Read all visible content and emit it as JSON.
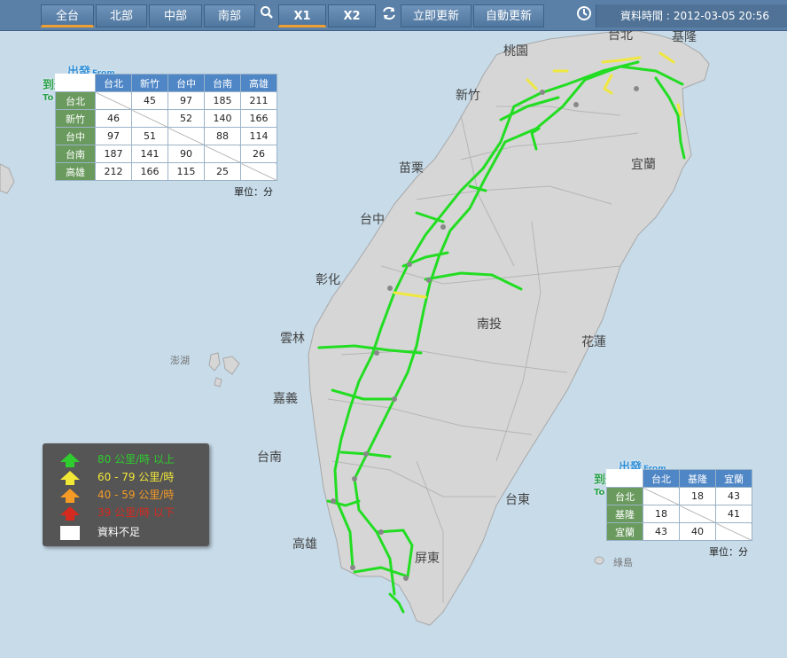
{
  "toolbar": {
    "tabs": [
      "全台",
      "北部",
      "中部",
      "南部"
    ],
    "zoom": [
      "X1",
      "X2"
    ],
    "refresh_now": "立即更新",
    "auto_refresh": "自動更新",
    "time_label": "資料時間 :",
    "time_value": "2012-03-05 20:56"
  },
  "map_labels": {
    "taoyuan": "桃園",
    "taipei": "台北",
    "keelung": "基隆",
    "hsinchu": "新竹",
    "miaoli": "苗栗",
    "yilan": "宜蘭",
    "taichung": "台中",
    "changhua": "彰化",
    "nantou": "南投",
    "yunlin": "雲林",
    "hualien": "花蓮",
    "penghu": "澎湖",
    "chiayi": "嘉義",
    "tainan": "台南",
    "taitung": "台東",
    "kaohsiung": "高雄",
    "pingtung": "屏東",
    "lyudao": "綠島"
  },
  "matrix_west": {
    "from_label": "出發",
    "from_en": "From",
    "to_label": "到達",
    "to_en": "To",
    "cols": [
      "台北",
      "新竹",
      "台中",
      "台南",
      "高雄"
    ],
    "rows": [
      {
        "name": "台北",
        "values": [
          "",
          "45",
          "97",
          "185",
          "211"
        ]
      },
      {
        "name": "新竹",
        "values": [
          "46",
          "",
          "52",
          "140",
          "166"
        ]
      },
      {
        "name": "台中",
        "values": [
          "97",
          "51",
          "",
          "88",
          "114"
        ]
      },
      {
        "name": "台南",
        "values": [
          "187",
          "141",
          "90",
          "",
          "26"
        ]
      },
      {
        "name": "高雄",
        "values": [
          "212",
          "166",
          "115",
          "25",
          ""
        ]
      }
    ],
    "unit": "單位：分"
  },
  "matrix_east": {
    "from_label": "出發",
    "from_en": "From",
    "to_label": "到達",
    "to_en": "To",
    "cols": [
      "台北",
      "基隆",
      "宜蘭"
    ],
    "rows": [
      {
        "name": "台北",
        "values": [
          "",
          "18",
          "43"
        ]
      },
      {
        "name": "基隆",
        "values": [
          "18",
          "",
          "41"
        ]
      },
      {
        "name": "宜蘭",
        "values": [
          "43",
          "40",
          ""
        ]
      }
    ],
    "unit": "單位：分"
  },
  "legend": [
    {
      "label": "80 公里/時 以上",
      "color": "#2ecc2e"
    },
    {
      "label": "60 - 79 公里/時",
      "color": "#f2e836"
    },
    {
      "label": "40 - 59 公里/時",
      "color": "#f59a25"
    },
    {
      "label": "39 公里/時 以下",
      "color": "#d62a1e"
    },
    {
      "label": "資料不足",
      "color": "#ffffff"
    }
  ],
  "colors": {
    "road_fast": "#22dd22",
    "road_mid": "#f0e840",
    "land": "#d6d6d6",
    "sea": "#c7dbe9"
  }
}
